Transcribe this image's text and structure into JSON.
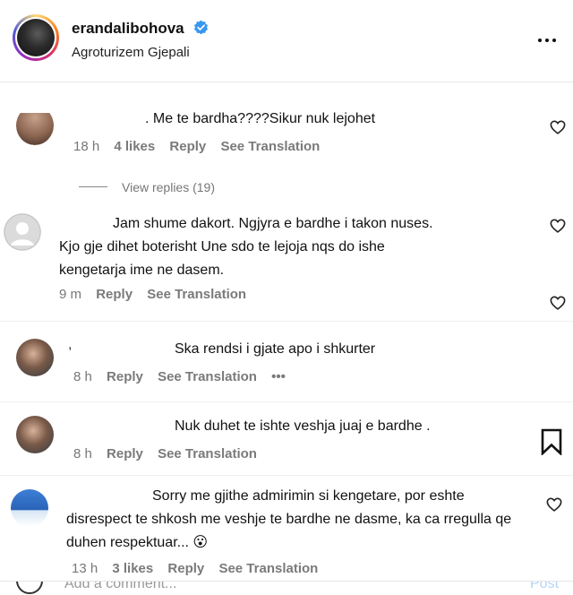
{
  "header": {
    "username": "erandalibohova",
    "location": "Agroturizem Gjepali"
  },
  "comments": [
    {
      "text": ". Me te bardha????Sikur nuk lejohet",
      "time": "18 h",
      "likes": "4 likes",
      "reply": "Reply",
      "translation": "See Translation"
    },
    {
      "view_replies": "View replies (19)"
    },
    {
      "text": "Jam shume dakort. Ngjyra e bardhe i takon nuses. Kjo gje dihet boterisht Une sdo te lejoja nqs do ishe kengetarja ime ne dasem.",
      "time": "9 m",
      "reply": "Reply",
      "translation": "See Translation"
    },
    {
      "text": "Ska rendsi i gjate apo i shkurter",
      "time": "8 h",
      "reply": "Reply",
      "translation": "See Translation",
      "more": "•••"
    },
    {
      "text": "Nuk duhet te ishte veshja juaj e bardhe .",
      "time": "8 h",
      "reply": "Reply",
      "translation": "See Translation"
    },
    {
      "text": "Sorry me gjithe admirimin si kengetare, por eshte disrespect te shkosh me veshje te bardhe ne dasme, ka ca rregulla qe duhen respektuar... 😮",
      "time": "13 h",
      "likes": "3 likes",
      "reply": "Reply",
      "translation": "See Translation"
    }
  ],
  "footer": {
    "placeholder": "Add a comment...",
    "post": "Post"
  },
  "colors": {
    "verified": "#3897f0",
    "meta": "#777777",
    "post_disabled": "#b3d4f5"
  }
}
